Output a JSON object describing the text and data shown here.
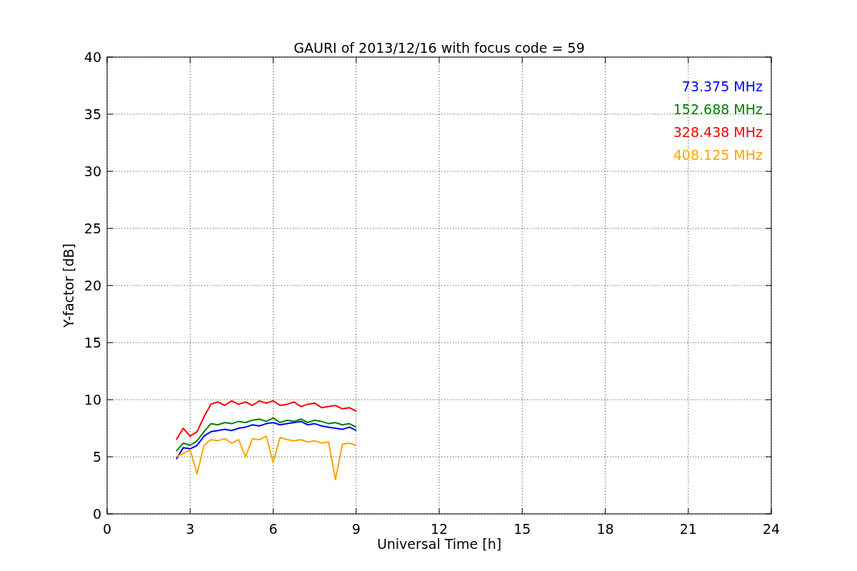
{
  "chart_data": {
    "type": "line",
    "title": "GAURI of 2013/12/16 with focus code = 59",
    "xlabel": "Universal Time [h]",
    "ylabel": "Y-factor [dB]",
    "x": [
      2.5,
      2.75,
      3.0,
      3.25,
      3.5,
      3.75,
      4.0,
      4.25,
      4.5,
      4.75,
      5.0,
      5.25,
      5.5,
      5.75,
      6.0,
      6.25,
      6.5,
      6.75,
      7.0,
      7.25,
      7.5,
      7.75,
      8.0,
      8.25,
      8.5,
      8.75,
      9.0
    ],
    "series": [
      {
        "name": "73.375 MHz",
        "color": "#0000ff",
        "values": [
          4.8,
          5.8,
          5.7,
          6.0,
          6.8,
          7.2,
          7.3,
          7.4,
          7.3,
          7.5,
          7.6,
          7.8,
          7.7,
          7.9,
          8.0,
          7.8,
          7.9,
          8.0,
          8.1,
          7.8,
          7.9,
          7.7,
          7.6,
          7.5,
          7.4,
          7.6,
          7.3
        ]
      },
      {
        "name": "152.688 MHz",
        "color": "#008000",
        "values": [
          5.5,
          6.2,
          6.0,
          6.4,
          7.2,
          7.9,
          7.8,
          8.0,
          7.9,
          8.1,
          8.0,
          8.2,
          8.3,
          8.1,
          8.4,
          8.0,
          8.2,
          8.1,
          8.3,
          8.0,
          8.2,
          8.1,
          7.9,
          8.0,
          7.8,
          7.9,
          7.6
        ]
      },
      {
        "name": "328.438 MHz",
        "color": "#ff0000",
        "values": [
          6.5,
          7.5,
          6.8,
          7.2,
          8.5,
          9.6,
          9.8,
          9.5,
          9.9,
          9.6,
          9.8,
          9.5,
          9.9,
          9.7,
          9.9,
          9.5,
          9.6,
          9.8,
          9.4,
          9.6,
          9.7,
          9.3,
          9.4,
          9.5,
          9.2,
          9.3,
          9.0
        ]
      },
      {
        "name": "408.125 MHz",
        "color": "#ffa500",
        "values": [
          5.0,
          5.3,
          5.6,
          3.5,
          6.0,
          6.5,
          6.4,
          6.6,
          6.2,
          6.5,
          5.0,
          6.6,
          6.5,
          6.8,
          4.5,
          6.7,
          6.5,
          6.4,
          6.5,
          6.3,
          6.4,
          6.2,
          6.3,
          3.0,
          6.1,
          6.2,
          6.0
        ]
      }
    ],
    "xlim": [
      0,
      24
    ],
    "ylim": [
      0,
      40
    ],
    "xticks": [
      0,
      3,
      6,
      9,
      12,
      15,
      18,
      21,
      24
    ],
    "yticks": [
      0,
      5,
      10,
      15,
      20,
      25,
      30,
      35,
      40
    ],
    "grid": true
  }
}
